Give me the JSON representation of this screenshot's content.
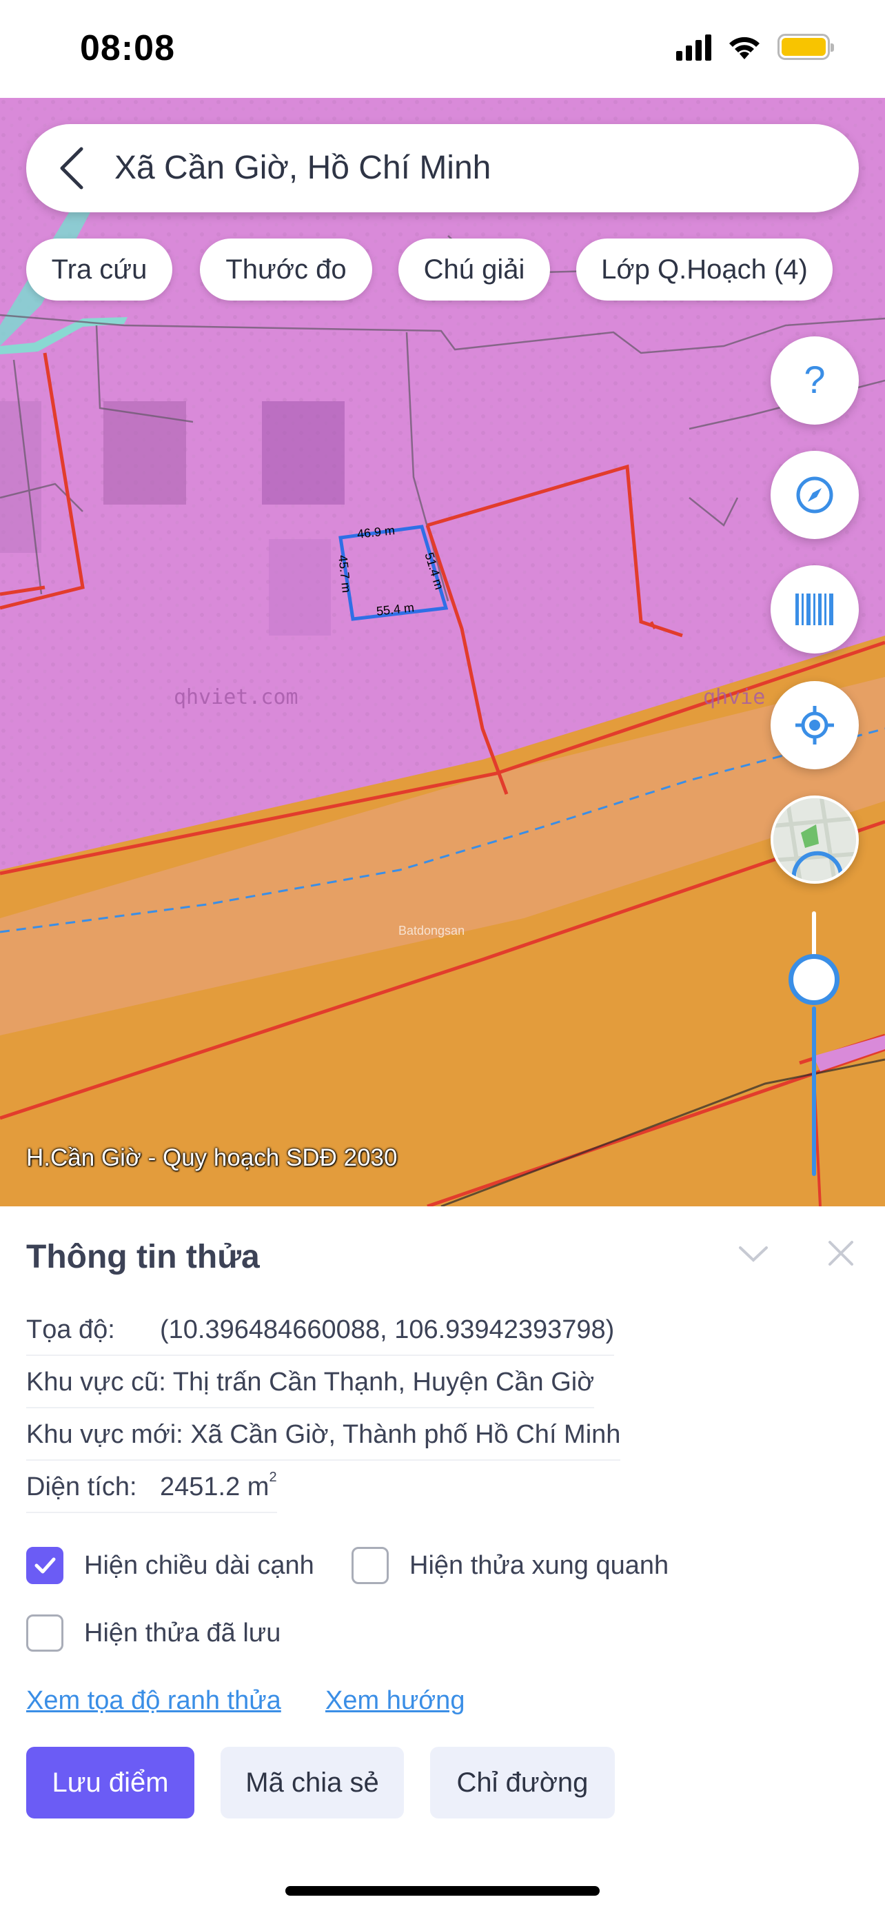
{
  "status_bar": {
    "time": "08:08"
  },
  "search": {
    "text": "Xã Cần Giờ, Hồ Chí Minh"
  },
  "chips": [
    "Tra cứu",
    "Thước đo",
    "Chú giải",
    "Lớp Q.Hoạch (4)"
  ],
  "fab_icons": [
    "help-icon",
    "compass-icon",
    "barcode-icon",
    "locate-icon",
    "map-thumbnail"
  ],
  "map": {
    "caption": "H.Cần Giờ - Quy hoạch SDĐ 2030",
    "watermarks": [
      "qhviet.com",
      "qhvie"
    ],
    "brand_watermark": "Batdongsan",
    "parcel_edges": [
      "46.9 m",
      "51.4 m",
      "45.7 m",
      "55.4 m"
    ],
    "zoom_level": 0.3,
    "colors": {
      "residential_zone": "#d98ad9",
      "green_zone": "#e3a07f",
      "road_zone": "#e39c3c",
      "boundary": "#e23c2c",
      "parcel_outline": "#2f6fe6"
    }
  },
  "panel": {
    "title": "Thông tin thửa",
    "rows": [
      {
        "label": "Tọa độ:",
        "value": "(10.396484660088, 106.93942393798)"
      },
      {
        "label": "Khu vực cũ:",
        "value": "Thị trấn Cần Thạnh, Huyện Cần Giờ"
      },
      {
        "label": "Khu vực mới:",
        "value": "Xã Cần Giờ, Thành phố Hồ Chí Minh"
      },
      {
        "label": "Diện tích:",
        "value": "2451.2 m",
        "unit_sup": "2"
      }
    ],
    "checkboxes": [
      {
        "label": "Hiện chiều dài cạnh",
        "checked": true
      },
      {
        "label": "Hiện thửa xung quanh",
        "checked": false
      },
      {
        "label": "Hiện thửa đã lưu",
        "checked": false
      }
    ],
    "links": [
      "Xem tọa độ ranh thửa",
      "Xem hướng"
    ],
    "buttons": {
      "save": "Lưu điểm",
      "share": "Mã chia sẻ",
      "directions": "Chỉ đường"
    }
  },
  "accent_color": "#6b5cf5",
  "link_color": "#3a8ee6"
}
